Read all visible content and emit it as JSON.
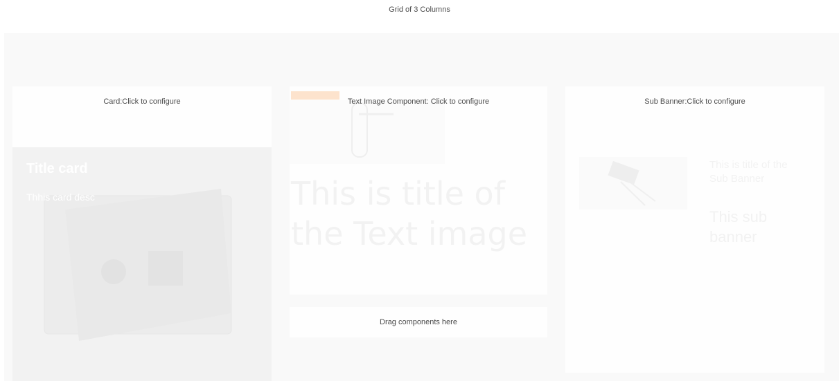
{
  "grid": {
    "title": "Grid of 3 Columns"
  },
  "card": {
    "placeholder": "Card:Click to configure",
    "title": "Title card",
    "description": "Thhis card desc",
    "image_icon": "safe-image"
  },
  "text_image": {
    "placeholder": "Text Image Component: Click to configure",
    "title": "This is title of the Text image",
    "image_icon": "door-handle-image"
  },
  "drop_zone": {
    "label": "Drag components here"
  },
  "sub_banner": {
    "placeholder": "Sub Banner:Click to configure",
    "title": "This is title of the Sub Banner",
    "description": "This sub banner",
    "image_icon": "keys-image"
  }
}
